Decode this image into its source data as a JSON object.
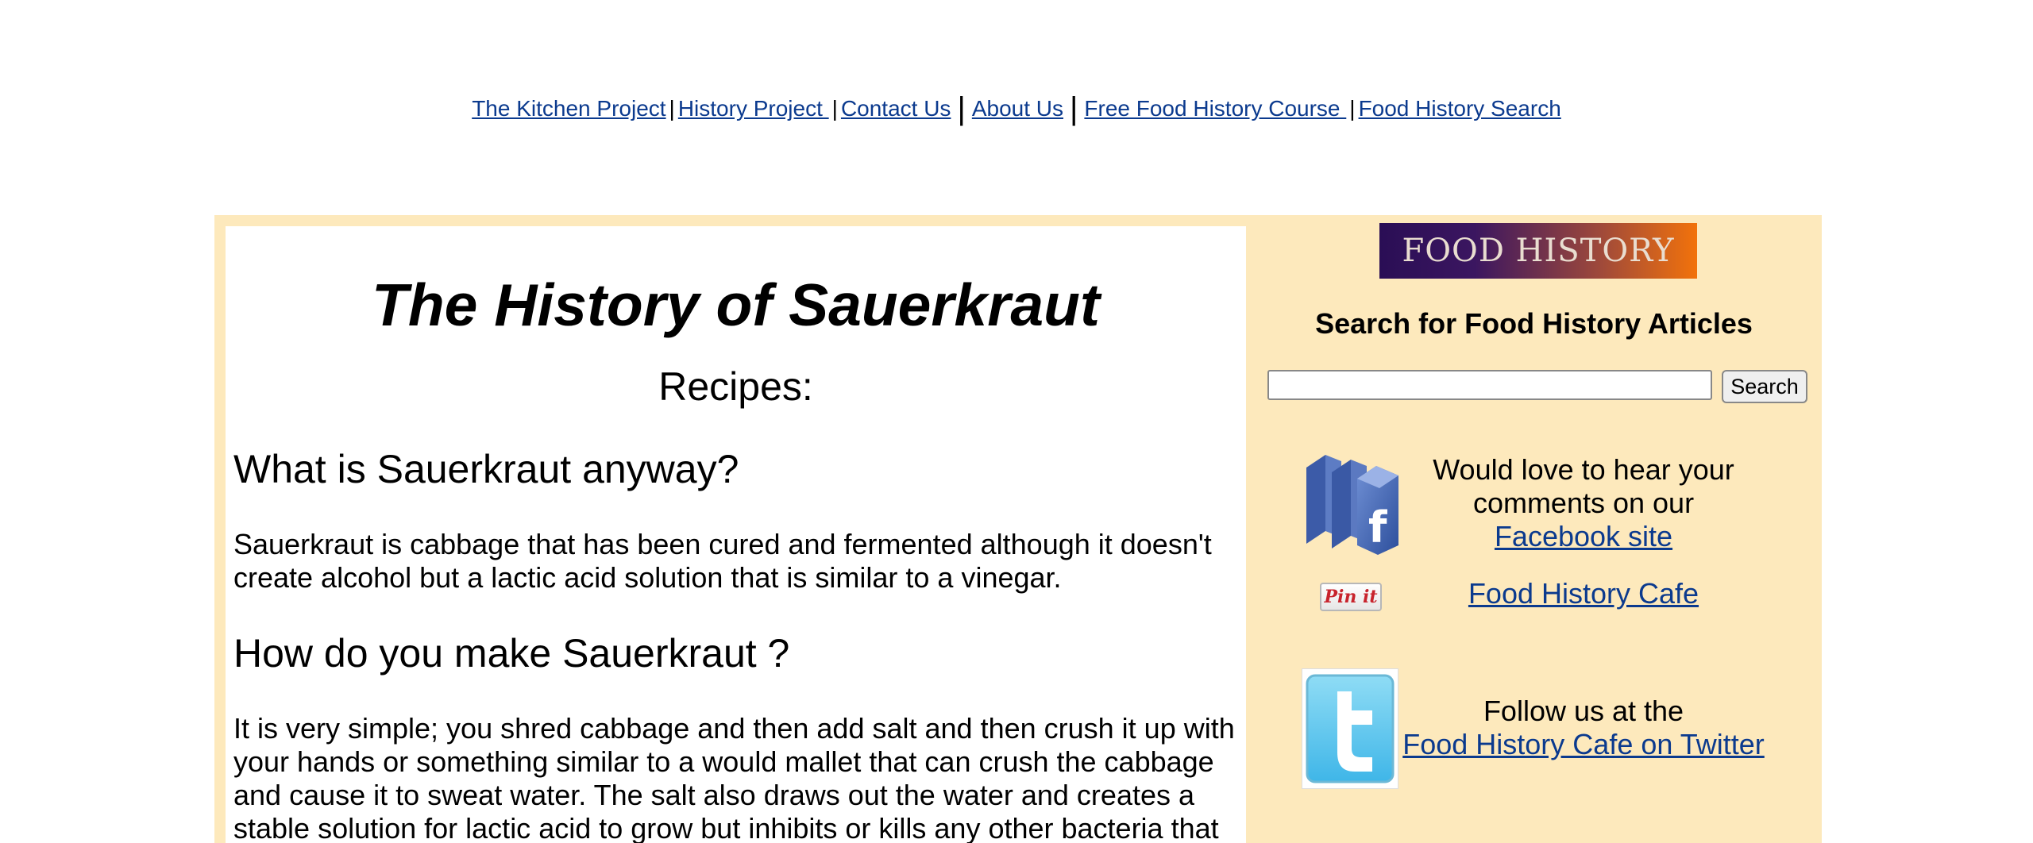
{
  "nav": {
    "items": [
      "The Kitchen Project",
      "History Project ",
      "Contact Us",
      "About Us",
      "Free Food History Course ",
      "Food History Search"
    ],
    "separators": [
      "|",
      "|",
      "|",
      "|",
      "|"
    ]
  },
  "article": {
    "title": "The History of Sauerkraut",
    "recipes_label": "Recipes:",
    "heading1": "What is Sauerkraut anyway?",
    "para1": "Sauerkraut is cabbage that has been cured and fermented although it doesn't create alcohol but a lactic acid solution that is similar to a vinegar.",
    "heading2": "How do you make Sauerkraut ?",
    "para2": "It is very simple; you shred cabbage and then add salt and then crush it up with your hands or something similar to a would mallet that can crush the cabbage and cause it to sweat water. The salt also draws out the water and creates a stable solution for lactic acid to grow but inhibits or kills any other bacteria that"
  },
  "sidebar": {
    "banner_text": "FOOD HISTORY",
    "search_heading": "Search for Food History Articles",
    "search_input_value": "",
    "search_button": "Search",
    "facebook_text": "Would love to hear your comments on our",
    "facebook_link": "Facebook site",
    "pin_label": "Pin it",
    "cafe_link": "Food History Cafe ",
    "twitter_text": "Follow us at the",
    "twitter_link": "Food History Cafe on Twitter"
  },
  "colors": {
    "link": "#0b3a8e",
    "frame_bg": "#fde9bc",
    "banner_start": "#2a0e55",
    "banner_end": "#f2720b"
  }
}
